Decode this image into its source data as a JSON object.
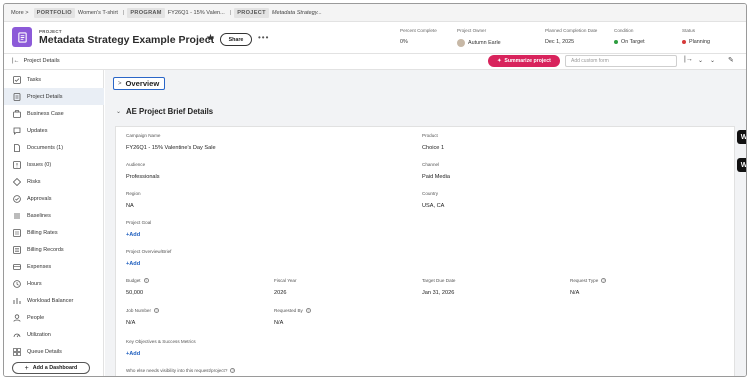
{
  "breadcrumb": {
    "more": "More >",
    "portfolio_tag": "PORTFOLIO",
    "portfolio_name": "Women's T-shirt",
    "program_tag": "PROGRAM",
    "program_name": "FY26Q1 - 15% Valen...",
    "project_tag": "PROJECT",
    "project_name": "Metadata Strategy..."
  },
  "header": {
    "object_label": "PROJECT",
    "title": "Metadata Strategy Example Project",
    "share_label": "Share",
    "more_label": "•••",
    "fields": [
      {
        "label": "Percent Complete",
        "value": "0%"
      },
      {
        "label": "Project Owner",
        "value": "Autumn Earle"
      },
      {
        "label": "Planned Completion Date",
        "value": "Dec 1, 2025"
      },
      {
        "label": "Condition",
        "value": "On Target"
      },
      {
        "label": "Status",
        "value": "Planning"
      }
    ],
    "colors": {
      "accent": "#8c5ad8",
      "on_target": "#2d9d3f",
      "planning": "#d63a3a"
    }
  },
  "toolbar": {
    "back_label": "Project Details",
    "summarize_label": "Summarize project",
    "custom_form_placeholder": "Add custom form",
    "icons": [
      "sidebar-toggle-icon",
      "chevron-down-icon",
      "pencil-icon"
    ]
  },
  "sidebar": {
    "items": [
      {
        "label": "Tasks",
        "icon": "tasks-icon"
      },
      {
        "label": "Project Details",
        "icon": "details-icon",
        "active": true
      },
      {
        "label": "Business Case",
        "icon": "business-case-icon"
      },
      {
        "label": "Updates",
        "icon": "updates-icon"
      },
      {
        "label": "Documents (1)",
        "icon": "documents-icon"
      },
      {
        "label": "Issues (0)",
        "icon": "issues-icon"
      },
      {
        "label": "Risks",
        "icon": "risks-icon"
      },
      {
        "label": "Approvals",
        "icon": "approvals-icon"
      },
      {
        "label": "Baselines",
        "icon": "baselines-icon"
      },
      {
        "label": "Billing Rates",
        "icon": "billing-rates-icon"
      },
      {
        "label": "Billing Records",
        "icon": "billing-records-icon"
      },
      {
        "label": "Expenses",
        "icon": "expenses-icon"
      },
      {
        "label": "Hours",
        "icon": "hours-icon"
      },
      {
        "label": "Workload Balancer",
        "icon": "workload-icon"
      },
      {
        "label": "People",
        "icon": "people-icon"
      },
      {
        "label": "Utilization",
        "icon": "utilization-icon"
      },
      {
        "label": "Queue Details",
        "icon": "queue-icon"
      }
    ],
    "add_dashboard_label": "Add a Dashboard"
  },
  "main": {
    "overview_label": "Overview",
    "section_title": "AE Project Brief Details",
    "add_label": "+Add",
    "fields": {
      "campaign_name": {
        "label": "Campaign Name",
        "value": "FY26Q1 - 15% Valentine's Day Sale"
      },
      "product": {
        "label": "Product",
        "value": "Choice 1"
      },
      "audience": {
        "label": "Audience",
        "value": "Professionals"
      },
      "channel": {
        "label": "Channel",
        "value": "Paid Media"
      },
      "region": {
        "label": "Region",
        "value": "NA"
      },
      "country": {
        "label": "Country",
        "value": "USA, CA"
      },
      "project_goal": {
        "label": "Project Goal"
      },
      "project_overview": {
        "label": "Project Overview/Brief"
      },
      "budget": {
        "label": "Budget",
        "value": "50,000"
      },
      "fiscal_year": {
        "label": "Fiscal Year",
        "value": "2026"
      },
      "target_due_date": {
        "label": "Target Due Date",
        "value": "Jan 31, 2026"
      },
      "request_type": {
        "label": "Request Type",
        "value": "N/A"
      },
      "job_number": {
        "label": "Job Number",
        "value": "N/A"
      },
      "requested_by": {
        "label": "Requested By",
        "value": "N/A"
      },
      "key_objectives": {
        "label": "Key Objectives & Success Metrics"
      },
      "visibility": {
        "label": "Who else needs visibility into this request/project?"
      }
    }
  },
  "widgets": {
    "label": "W"
  }
}
